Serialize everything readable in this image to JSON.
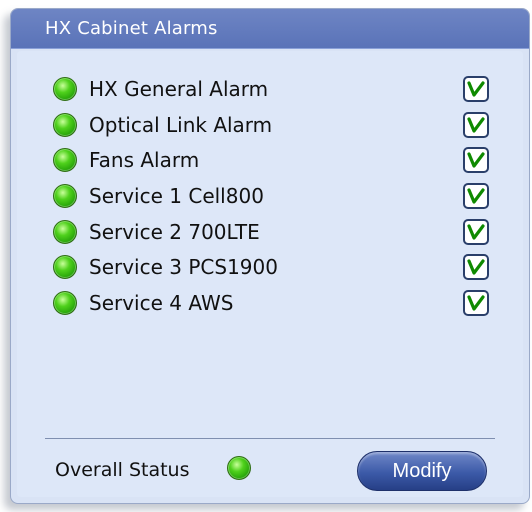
{
  "panel": {
    "title": "HX Cabinet Alarms"
  },
  "alarms": [
    {
      "label": "HX General Alarm",
      "status": "ok",
      "enabled": true
    },
    {
      "label": "Optical Link Alarm",
      "status": "ok",
      "enabled": true
    },
    {
      "label": "Fans Alarm",
      "status": "ok",
      "enabled": true
    },
    {
      "label": "Service 1 Cell800",
      "status": "ok",
      "enabled": true
    },
    {
      "label": "Service 2 700LTE",
      "status": "ok",
      "enabled": true
    },
    {
      "label": "Service 3 PCS1900",
      "status": "ok",
      "enabled": true
    },
    {
      "label": "Service 4 AWS",
      "status": "ok",
      "enabled": true
    }
  ],
  "footer": {
    "overall_label": "Overall Status",
    "overall_status": "ok",
    "modify_label": "Modify"
  },
  "colors": {
    "title_bar": "#5a73b8",
    "panel_bg": "#dde7f8",
    "status_ok": "#4fd11c",
    "button": "#3c5aa8"
  }
}
